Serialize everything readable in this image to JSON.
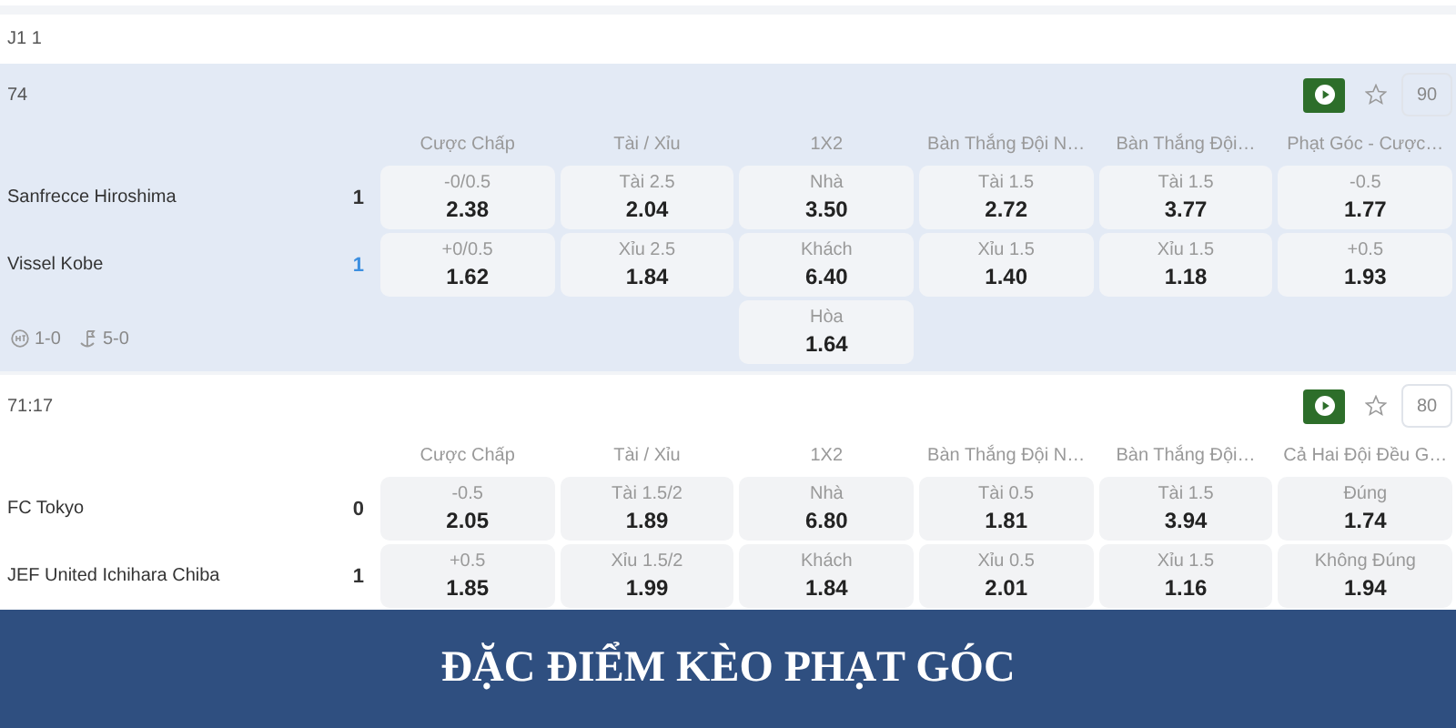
{
  "league": {
    "title": "J1 1"
  },
  "matches": [
    {
      "time": "74",
      "count": "90",
      "shaded": true,
      "markets": [
        {
          "title": "Cược Chấp",
          "options": [
            {
              "label": "-0/0.5",
              "odd": "2.38"
            },
            {
              "label": "+0/0.5",
              "odd": "1.62"
            }
          ]
        },
        {
          "title": "Tài / Xỉu",
          "options": [
            {
              "label": "Tài 2.5",
              "odd": "2.04"
            },
            {
              "label": "Xỉu 2.5",
              "odd": "1.84"
            }
          ]
        },
        {
          "title": "1X2",
          "options": [
            {
              "label": "Nhà",
              "odd": "3.50"
            },
            {
              "label": "Khách",
              "odd": "6.40"
            },
            {
              "label": "Hòa",
              "odd": "1.64"
            }
          ]
        },
        {
          "title": "Bàn Thắng Đội N…",
          "options": [
            {
              "label": "Tài 1.5",
              "odd": "2.72"
            },
            {
              "label": "Xỉu 1.5",
              "odd": "1.40"
            }
          ]
        },
        {
          "title": "Bàn Thắng Đội…",
          "options": [
            {
              "label": "Tài 1.5",
              "odd": "3.77"
            },
            {
              "label": "Xỉu 1.5",
              "odd": "1.18"
            }
          ]
        },
        {
          "title": "Phạt Góc - Cược…",
          "options": [
            {
              "label": "-0.5",
              "odd": "1.77"
            },
            {
              "label": "+0.5",
              "odd": "1.93"
            }
          ]
        }
      ],
      "teams": [
        {
          "name": "Sanfrecce Hiroshima",
          "score": "1",
          "highlight": false
        },
        {
          "name": "Vissel Kobe",
          "score": "1",
          "highlight": true
        }
      ],
      "stats": [
        {
          "kind": "halftime",
          "text": "1-0"
        },
        {
          "kind": "corner",
          "text": "5-0"
        }
      ]
    },
    {
      "time": "71:17",
      "count": "80",
      "shaded": false,
      "markets": [
        {
          "title": "Cược Chấp",
          "options": [
            {
              "label": "-0.5",
              "odd": "2.05"
            },
            {
              "label": "+0.5",
              "odd": "1.85"
            }
          ]
        },
        {
          "title": "Tài / Xỉu",
          "options": [
            {
              "label": "Tài 1.5/2",
              "odd": "1.89"
            },
            {
              "label": "Xỉu 1.5/2",
              "odd": "1.99"
            }
          ]
        },
        {
          "title": "1X2",
          "options": [
            {
              "label": "Nhà",
              "odd": "6.80"
            },
            {
              "label": "Khách",
              "odd": "1.84"
            }
          ]
        },
        {
          "title": "Bàn Thắng Đội N…",
          "options": [
            {
              "label": "Tài 0.5",
              "odd": "1.81"
            },
            {
              "label": "Xỉu 0.5",
              "odd": "2.01"
            }
          ]
        },
        {
          "title": "Bàn Thắng Đội…",
          "options": [
            {
              "label": "Tài 1.5",
              "odd": "3.94"
            },
            {
              "label": "Xỉu 1.5",
              "odd": "1.16"
            }
          ]
        },
        {
          "title": "Cả Hai Đội Đều G…",
          "options": [
            {
              "label": "Đúng",
              "odd": "1.74"
            },
            {
              "label": "Không Đúng",
              "odd": "1.94"
            }
          ]
        }
      ],
      "teams": [
        {
          "name": "FC Tokyo",
          "score": "0",
          "highlight": false
        },
        {
          "name": "JEF United Ichihara Chiba",
          "score": "1",
          "highlight": false
        }
      ]
    }
  ],
  "banner": {
    "title": "ĐẶC ĐIỂM KÈO PHẠT GÓC"
  }
}
